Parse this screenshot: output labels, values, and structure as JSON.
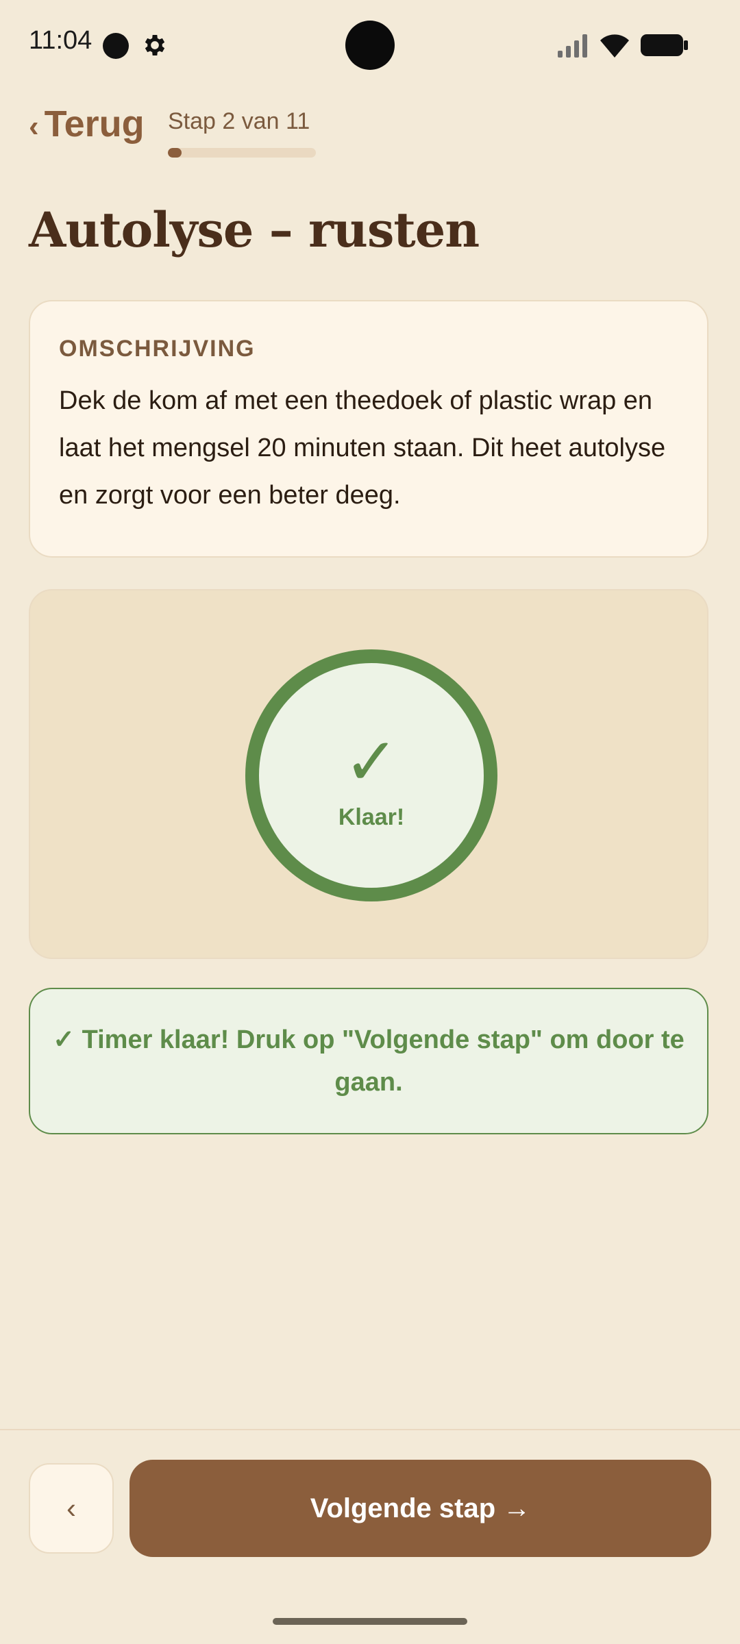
{
  "status_bar": {
    "time": "11:04",
    "icons": [
      "notification-dot-icon",
      "gear-icon",
      "signal-icon",
      "wifi-icon",
      "battery-icon"
    ]
  },
  "nav": {
    "back_chevron": "‹",
    "back_label": "Terug",
    "step_label": "Stap 2 van 11",
    "progress_fraction": 0.0909
  },
  "step": {
    "title": "Autolyse – rusten",
    "description_heading": "OMSCHRIJVING",
    "description": "Dek de kom af met een theedoek of plastic wrap en laat het mengsel 20 minuten staan. Dit heet autolyse en zorgt voor een beter deeg."
  },
  "timer": {
    "check_glyph": "✓",
    "status_label": "Klaar!"
  },
  "banner": {
    "message": "✓ Timer klaar! Druk op \"Volgende stap\" om door te gaan."
  },
  "footer": {
    "prev_label": "‹",
    "next_label": "Volgende stap →"
  },
  "colors": {
    "background": "#f3ead8",
    "brand_brown": "#8b5e3c",
    "title_brown": "#4a2e1b",
    "success_green": "#5e8c4a",
    "success_bg": "#edf3e6",
    "card_bg": "#fdf5e8",
    "timer_card_bg": "#efe1c6"
  }
}
